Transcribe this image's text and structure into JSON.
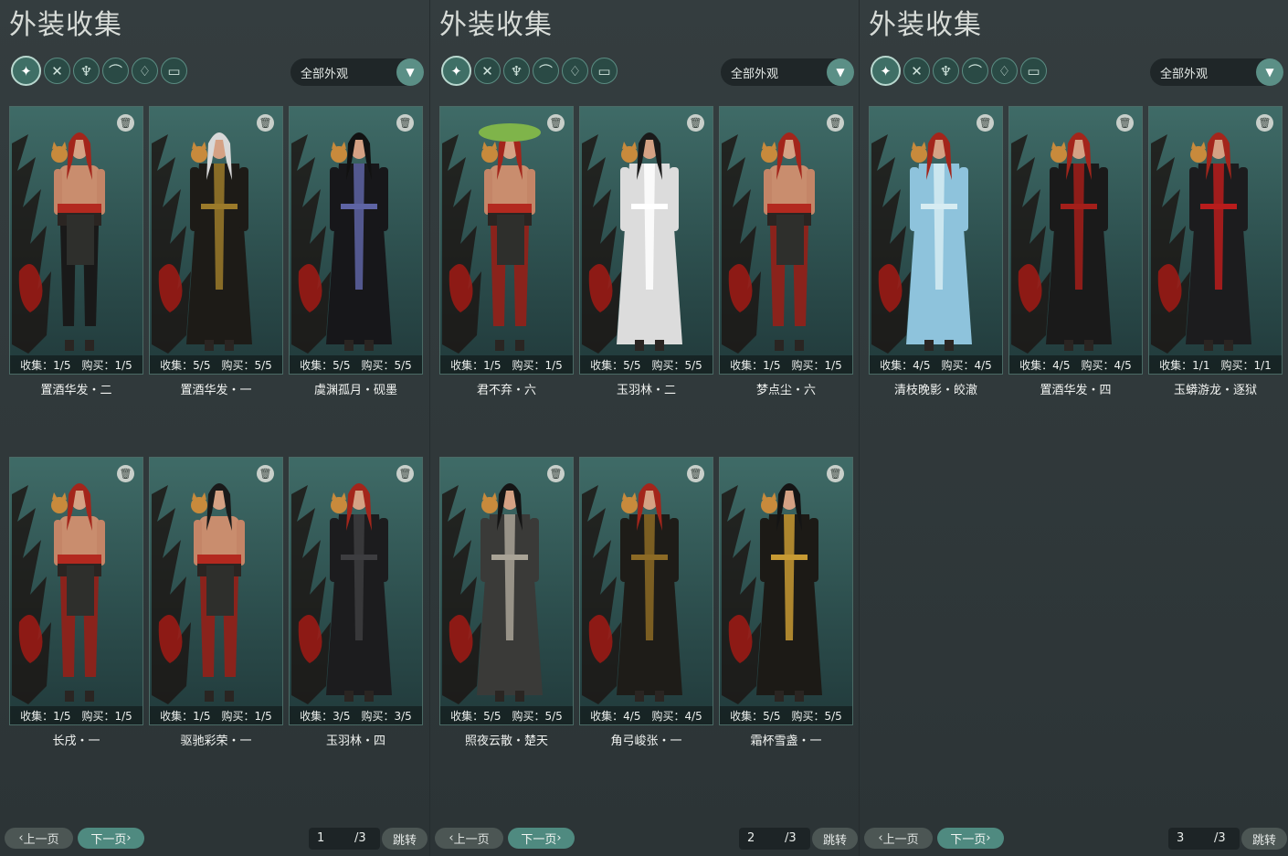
{
  "panels": [
    {
      "title": "外装收集",
      "filter": "全部外观",
      "prev": "上一页",
      "next": "下一页",
      "page": "1",
      "total": "/3",
      "jump": "跳转",
      "items": [
        {
          "collect": "收集：1/5",
          "buy": "购买：1/5",
          "name": "置酒华发・二",
          "outfit": "shirtless",
          "pants": "#191919",
          "hair": "#a3251b"
        },
        {
          "collect": "收集：5/5",
          "buy": "购买：5/5",
          "name": "置酒华发・一",
          "outfit": "robe",
          "robe": "#1d1b17",
          "trim": "#9b7a2a",
          "hair": "#d8d8d8"
        },
        {
          "collect": "收集：5/5",
          "buy": "购买：5/5",
          "name": "虞渊孤月・砚墨",
          "outfit": "robe",
          "robe": "#17171a",
          "trim": "#5e64a4",
          "hair": "#121212"
        },
        {
          "collect": "收集：1/5",
          "buy": "购买：1/5",
          "name": "长戌・一",
          "outfit": "shirtless",
          "pants": "#8a231c",
          "hair": "#a3251b"
        },
        {
          "collect": "收集：1/5",
          "buy": "购买：1/5",
          "name": "驱驰彩荣・一",
          "outfit": "shirtless",
          "pants": "#8a231c",
          "hair": "#1a1a1a"
        },
        {
          "collect": "收集：3/5",
          "buy": "购买：3/5",
          "name": "玉羽林・四",
          "outfit": "robe",
          "robe": "#1c1c1e",
          "trim": "#3d3d40",
          "hair": "#a3251b"
        }
      ]
    },
    {
      "title": "外装收集",
      "filter": "全部外观",
      "prev": "上一页",
      "next": "下一页",
      "page": "2",
      "total": "/3",
      "jump": "跳转",
      "items": [
        {
          "collect": "收集：1/5",
          "buy": "购买：1/5",
          "name": "君不弃・六",
          "outfit": "shirtless",
          "pants": "#8a231c",
          "hair": "#a3251b",
          "hat": true
        },
        {
          "collect": "收集：5/5",
          "buy": "购买：5/5",
          "name": "玉羽林・二",
          "outfit": "robe",
          "robe": "#dcdcdc",
          "trim": "#ffffff",
          "hair": "#1a1a1a"
        },
        {
          "collect": "收集：1/5",
          "buy": "购买：1/5",
          "name": "梦点尘・六",
          "outfit": "shirtless",
          "pants": "#8a231c",
          "hair": "#a3251b"
        },
        {
          "collect": "收集：5/5",
          "buy": "购买：5/5",
          "name": "照夜云散・楚天",
          "outfit": "robe",
          "robe": "#3a3a38",
          "trim": "#a9a396",
          "hair": "#151515"
        },
        {
          "collect": "收集：4/5",
          "buy": "购买：4/5",
          "name": "角弓峻张・一",
          "outfit": "robe",
          "robe": "#1e1c18",
          "trim": "#8c6a25",
          "hair": "#a3251b"
        },
        {
          "collect": "收集：5/5",
          "buy": "购买：5/5",
          "name": "霜杯雪盏・一",
          "outfit": "robe",
          "robe": "#1c1a16",
          "trim": "#c79a33",
          "hair": "#151515"
        }
      ]
    },
    {
      "title": "外装收集",
      "filter": "全部外观",
      "prev": "上一页",
      "next": "下一页",
      "page": "3",
      "total": "/3",
      "jump": "跳转",
      "items": [
        {
          "collect": "收集：4/5",
          "buy": "购买：4/5",
          "name": "清枝晚影・皎澈",
          "outfit": "robe",
          "robe": "#8ec3dc",
          "trim": "#d6ecf2",
          "hair": "#a3251b"
        },
        {
          "collect": "收集：4/5",
          "buy": "购买：4/5",
          "name": "置酒华发・四",
          "outfit": "robe",
          "robe": "#1a1a1a",
          "trim": "#a31f1a",
          "hair": "#a3251b"
        },
        {
          "collect": "收集：1/1",
          "buy": "购买：1/1",
          "name": "玉蟒游龙・逐狱",
          "outfit": "robe",
          "robe": "#1c1c1e",
          "trim": "#b81c1c",
          "hair": "#a3251b"
        }
      ]
    }
  ],
  "category_icons": [
    "outfit-icon",
    "hat-icon",
    "top-icon",
    "shoe-icon",
    "cape-icon",
    "bottom-icon"
  ],
  "colors": {
    "accent": "#4f8a80",
    "panel_bg": "#343d3f",
    "card_bg": "#3f6b67"
  }
}
